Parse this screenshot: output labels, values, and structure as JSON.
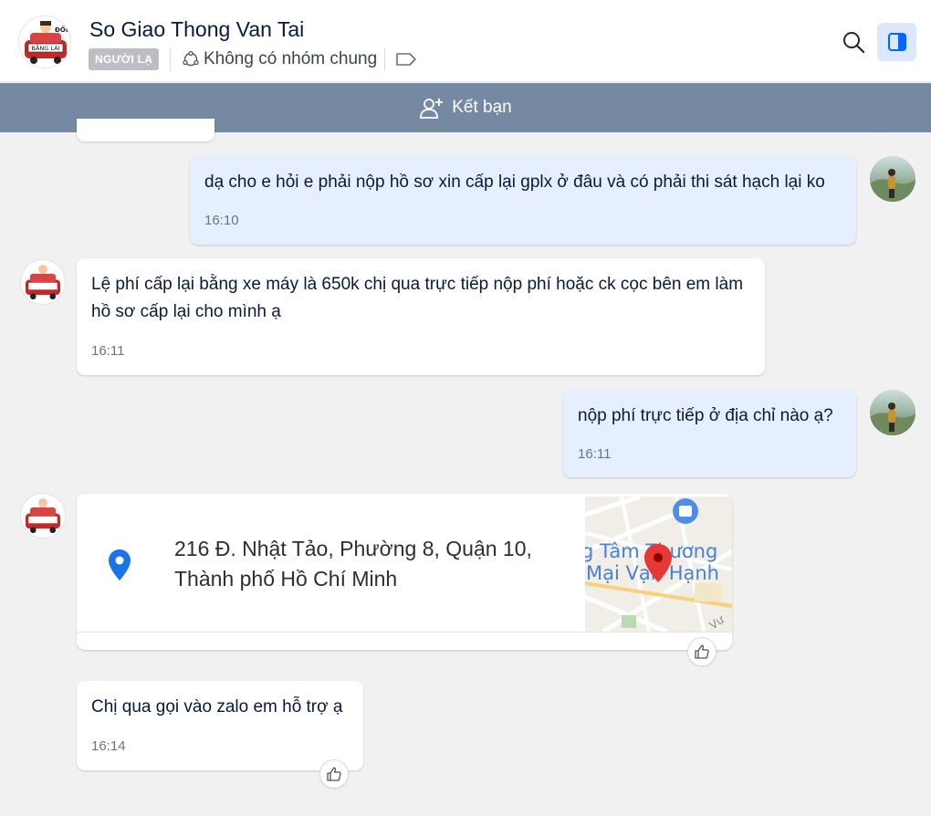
{
  "header": {
    "contact_name": "So Giao Thong Van Tai",
    "stranger_badge": "NGƯỜI LẠ",
    "mutual_groups": "Không có nhóm chung",
    "avatar_text_top": "ĐỔI",
    "avatar_text_bottom": "BẰNG LÁI",
    "icons": {
      "groups": "groups-icon",
      "tag": "tag-icon",
      "search": "search-icon",
      "panel": "sidebar-toggle-icon"
    },
    "accent_color": "#0068ff"
  },
  "add_friend_bar": {
    "label": "Kết bạn",
    "icon": "add-user-icon",
    "background": "#7589a3"
  },
  "messages": [
    {
      "direction": "sent",
      "text": "dạ cho e hỏi e phải nộp hồ sơ xin cấp lại gplx ở đâu và có phải thi sát hạch lại ko",
      "time": "16:10"
    },
    {
      "direction": "received",
      "text": "Lệ phí cấp lại bằng xe máy là 650k chị qua trực tiếp nộp phí hoặc ck cọc bên em làm hồ sơ cấp lại cho mình ạ",
      "time": "16:11"
    },
    {
      "direction": "sent",
      "text": "nộp phí trực tiếp ở địa chỉ nào ạ?",
      "time": "16:11"
    },
    {
      "direction": "received",
      "type": "location",
      "address_line1": "216 Đ. Nhật Tảo, Phường 8, Quận 10,",
      "address_line2": "Thành phố Hồ Chí Minh",
      "map_label_line1": "g Tâm Thương",
      "map_label_line2": "Mại Vạn Hạnh",
      "map_road_label": "Vư"
    },
    {
      "direction": "received",
      "text": "Chị qua gọi vào zalo em hỗ trợ ạ",
      "time": "16:14"
    }
  ],
  "colors": {
    "sent_bubble": "#e5efff",
    "received_bubble": "#ffffff",
    "chat_background": "#f1f1f1",
    "map_pin": "#e53935",
    "location_pin": "#1a73e8"
  }
}
